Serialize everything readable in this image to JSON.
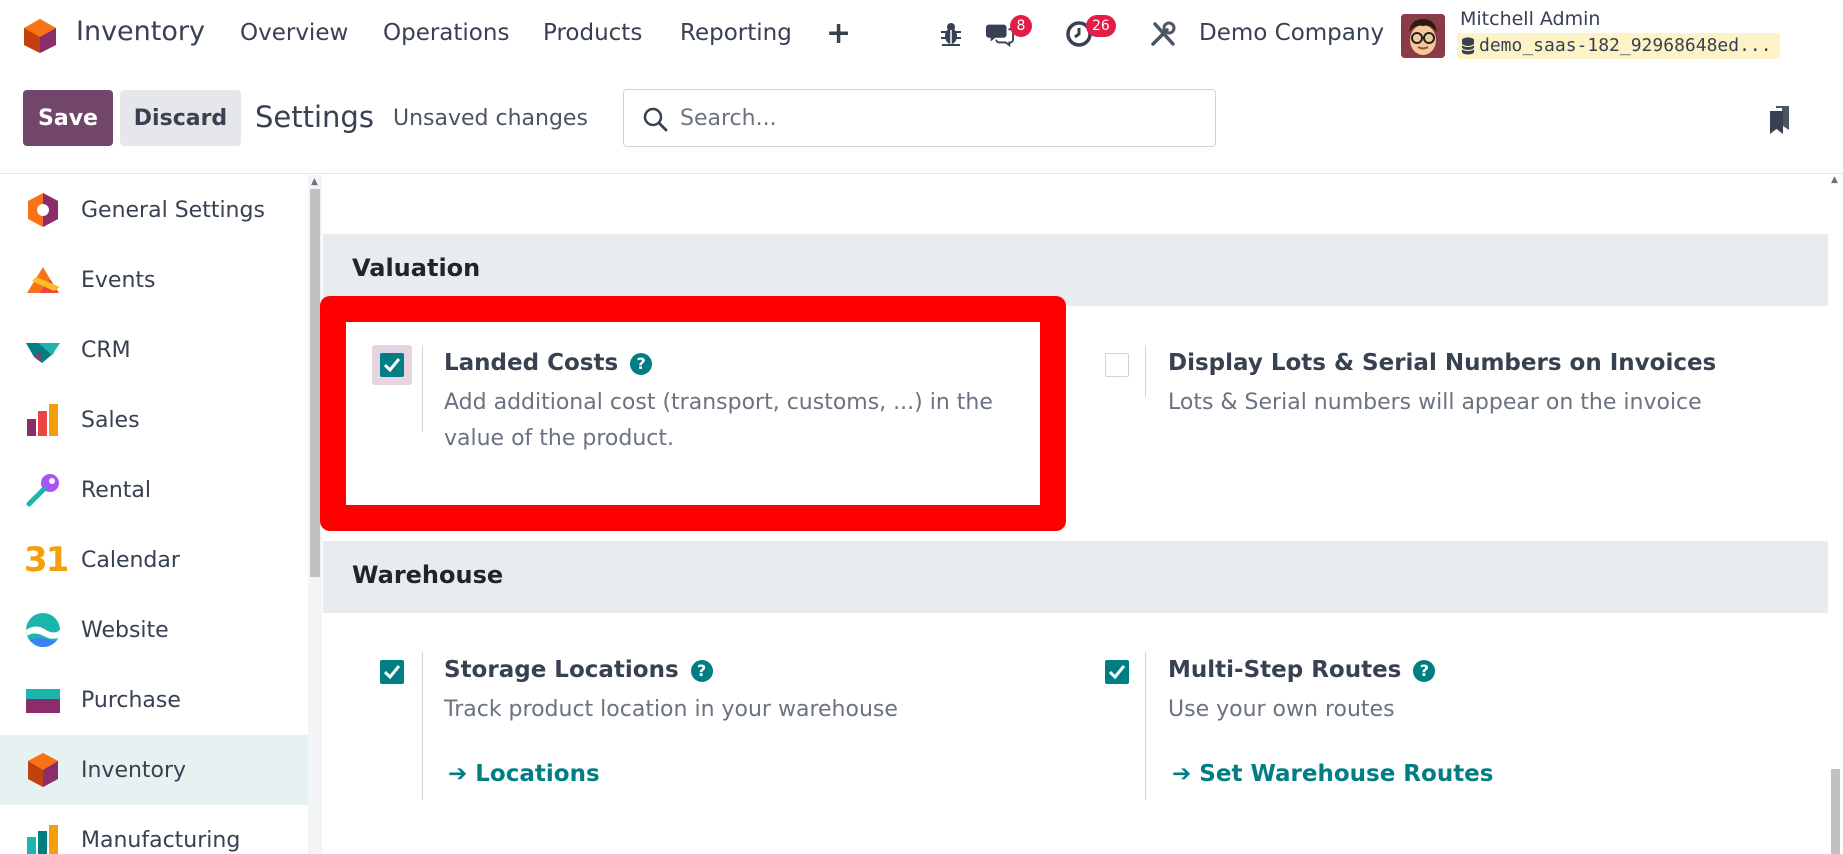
{
  "topnav": {
    "app_name": "Inventory",
    "menu": [
      "Overview",
      "Operations",
      "Products",
      "Reporting"
    ],
    "plus": "+",
    "chat_badge": "8",
    "activity_badge": "26",
    "company": "Demo Company",
    "user_name": "Mitchell Admin",
    "database": "demo_saas-182_92968648ed..."
  },
  "controlbar": {
    "save_label": "Save",
    "discard_label": "Discard",
    "title": "Settings",
    "status": "Unsaved changes",
    "search_placeholder": "Search..."
  },
  "sidebar": {
    "items": [
      {
        "label": "General Settings",
        "icon": "general-settings-icon"
      },
      {
        "label": "Events",
        "icon": "events-icon"
      },
      {
        "label": "CRM",
        "icon": "crm-icon"
      },
      {
        "label": "Sales",
        "icon": "sales-icon"
      },
      {
        "label": "Rental",
        "icon": "rental-icon"
      },
      {
        "label": "Calendar",
        "icon": "calendar-icon",
        "glyph": "31"
      },
      {
        "label": "Website",
        "icon": "website-icon"
      },
      {
        "label": "Purchase",
        "icon": "purchase-icon"
      },
      {
        "label": "Inventory",
        "icon": "inventory-icon",
        "active": true
      },
      {
        "label": "Manufacturing",
        "icon": "manufacturing-icon"
      }
    ]
  },
  "sections": {
    "valuation": {
      "title": "Valuation",
      "landed_costs": {
        "title": "Landed Costs",
        "checked": true,
        "desc_line1": "Add additional cost (transport, customs, ...) in the",
        "desc_line2": "value of the product."
      },
      "lots_on_invoices": {
        "title": "Display Lots & Serial Numbers on Invoices",
        "checked": false,
        "desc": "Lots & Serial numbers will appear on the invoice"
      }
    },
    "warehouse": {
      "title": "Warehouse",
      "storage_locations": {
        "title": "Storage Locations",
        "checked": true,
        "desc": "Track product location in your warehouse",
        "link": "Locations"
      },
      "multi_step_routes": {
        "title": "Multi-Step Routes",
        "checked": true,
        "desc": "Use your own routes",
        "link": "Set Warehouse Routes"
      }
    }
  },
  "colors": {
    "primary": "#71466a",
    "accent": "#017e84",
    "badge": "#e11d48",
    "highlight": "#ff0000"
  }
}
